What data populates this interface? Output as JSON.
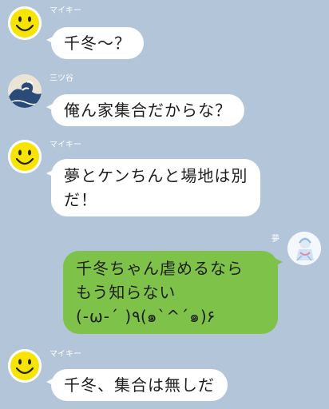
{
  "colors": {
    "background": "#b3c5d8",
    "incoming_bubble": "#ffffff",
    "outgoing_bubble": "#7fc24a",
    "smiley_yellow": "#f7e400"
  },
  "messages": [
    {
      "sender": "マイキー",
      "avatar_icon": "smiley-face-icon",
      "text": "千冬〜？"
    },
    {
      "sender": "三ツ谷",
      "avatar_icon": "great-wave-icon",
      "text": "俺ん家集合だからな？"
    },
    {
      "sender": "マイキー",
      "avatar_icon": "smiley-face-icon",
      "text": "夢とケンちんと場地は別\nだ！"
    },
    {
      "sender": "夢",
      "avatar_icon": "anime-character-icon",
      "text": "千冬ちゃん虐めるなら\nもう知らない\n(-ω-´ )٩(๑`^´๑)۶"
    },
    {
      "sender": "マイキー",
      "avatar_icon": "smiley-face-icon",
      "text": "千冬、集合は無しだ"
    }
  ]
}
